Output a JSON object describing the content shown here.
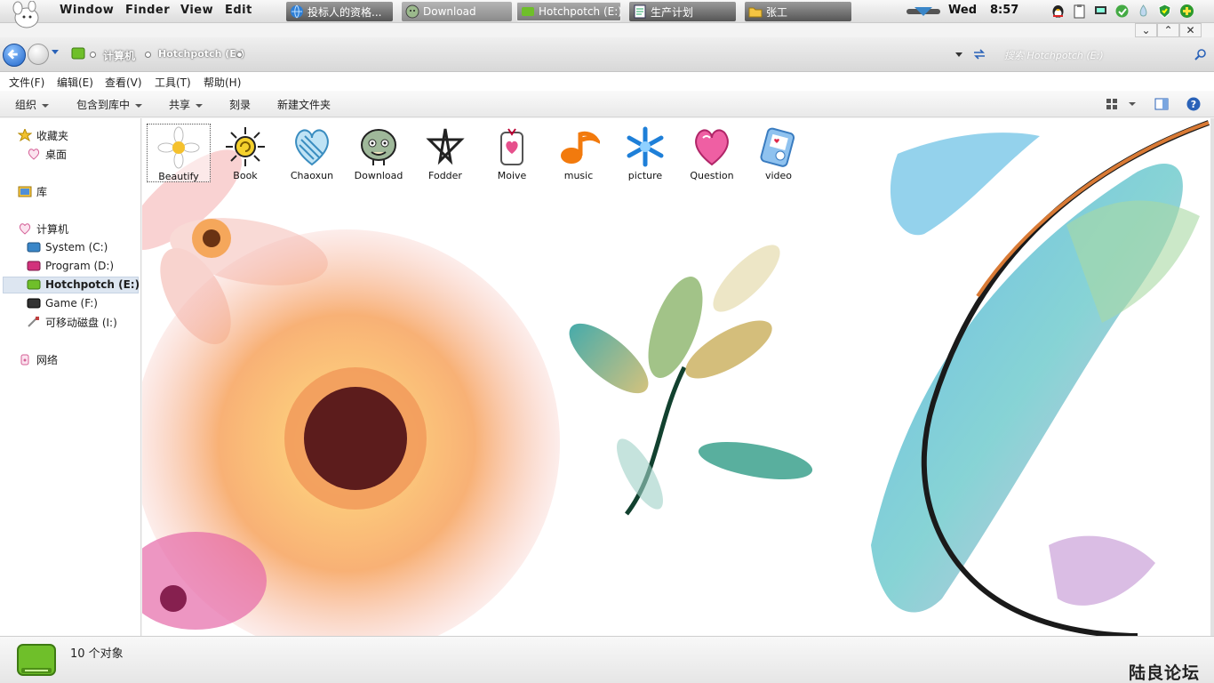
{
  "top_menu": {
    "window": "Window",
    "finder": "Finder",
    "view": "View",
    "edit": "Edit"
  },
  "taskbar": [
    {
      "label": "投标人的资格...",
      "icon": "globe-icon"
    },
    {
      "label": "Download",
      "icon": "folder-face-icon"
    },
    {
      "label": "Hotchpotch (E:)",
      "icon": "drive-green-icon"
    },
    {
      "label": "生产计划",
      "icon": "document-icon"
    },
    {
      "label": "张工",
      "icon": "folder-yellow-icon"
    }
  ],
  "clock": {
    "day": "Wed",
    "time": "8:57"
  },
  "window_controls": {
    "minimize": "⌄",
    "maximize": "⌃",
    "close": "✕"
  },
  "breadcrumb": {
    "computer": "计算机",
    "drive": "Hotchpotch (E:)"
  },
  "search": {
    "placeholder": "搜索 Hotchpotch (E:)"
  },
  "menubar": {
    "file": "文件(F)",
    "edit": "编辑(E)",
    "view": "查看(V)",
    "tools": "工具(T)",
    "help": "帮助(H)"
  },
  "toolbar": {
    "organize": "组织",
    "include_library": "包含到库中",
    "share": "共享",
    "burn": "刻录",
    "new_folder": "新建文件夹"
  },
  "sidebar": {
    "favorites": "收藏夹",
    "desktop": "桌面",
    "library": "库",
    "computer": "计算机",
    "drives": [
      {
        "label": "System (C:)",
        "color": "#3a86c8"
      },
      {
        "label": "Program (D:)",
        "color": "#d2327c"
      },
      {
        "label": "Hotchpotch (E:)",
        "color": "#6fbf2a"
      },
      {
        "label": "Game (F:)",
        "color": "#333333"
      },
      {
        "label": "可移动磁盘 (I:)",
        "color": "#c04040"
      }
    ],
    "network": "网络"
  },
  "folders": [
    {
      "label": "Beautify",
      "icon": "daisy-icon"
    },
    {
      "label": "Book",
      "icon": "sun-icon"
    },
    {
      "label": "Chaoxun",
      "icon": "blue-heart-icon"
    },
    {
      "label": "Download",
      "icon": "face-mascot-icon"
    },
    {
      "label": "Fodder",
      "icon": "star-doodle-icon"
    },
    {
      "label": "Moive",
      "icon": "cup-heart-icon"
    },
    {
      "label": "music",
      "icon": "music-note-icon"
    },
    {
      "label": "picture",
      "icon": "snowflake-icon"
    },
    {
      "label": "Question",
      "icon": "pink-heart-icon"
    },
    {
      "label": "video",
      "icon": "media-player-icon"
    }
  ],
  "status": {
    "count": "10 个对象"
  },
  "watermark": "陆良论坛"
}
